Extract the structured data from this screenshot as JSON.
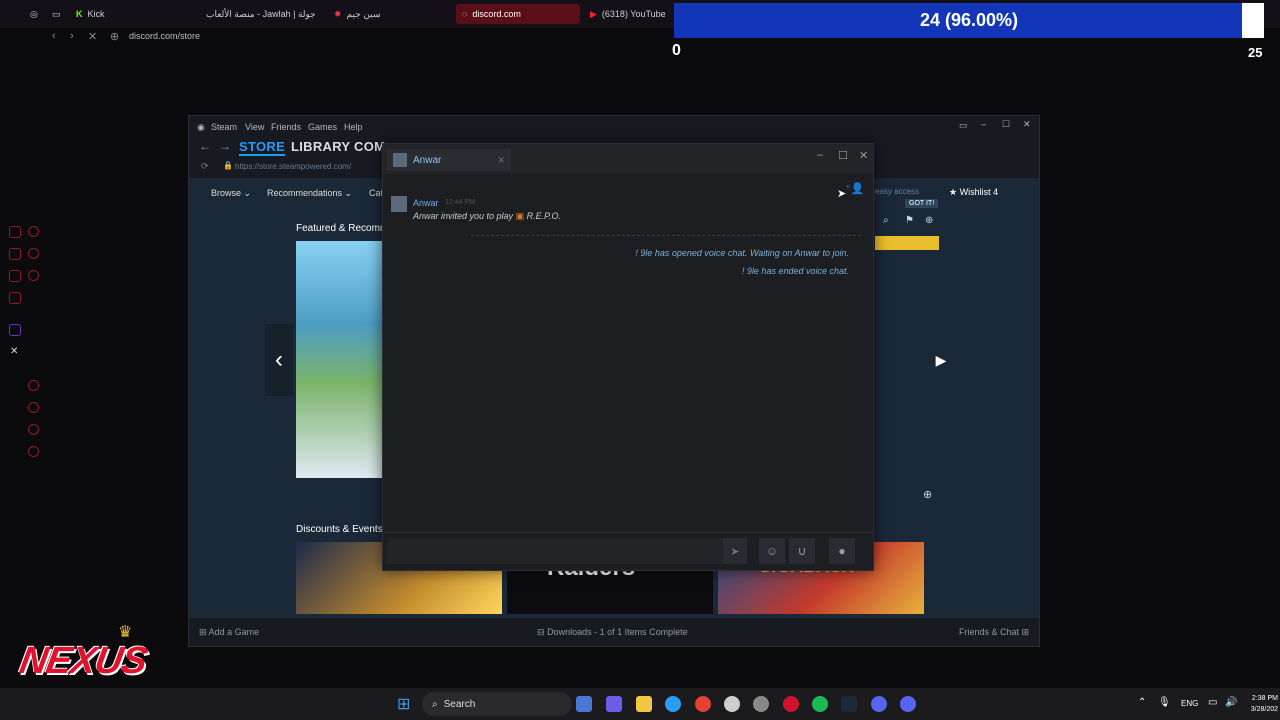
{
  "browser": {
    "tabs": [
      {
        "label": "Kick"
      },
      {
        "label": "منصة الألعاب - Jawlah | جولة"
      },
      {
        "label": "سبن جيم"
      },
      {
        "label": "discord.com"
      },
      {
        "label": "(6318) YouTube"
      }
    ],
    "url": "discord.com/store"
  },
  "overlay": {
    "progress_text": "24 (96.00%)",
    "progress_value": 0.96,
    "counter_left": "0",
    "counter_right": "25"
  },
  "steam": {
    "menu": [
      "Steam",
      "View",
      "Friends",
      "Games",
      "Help"
    ],
    "nav": {
      "store": "STORE",
      "library": "LIBRARY",
      "community": "COM"
    },
    "url": "https://store.steampowered.com/",
    "subnav": [
      "Browse",
      "Recommendations",
      "Cat"
    ],
    "wishlist": "Wishlist 4",
    "easy_access": "easy access",
    "got_it": "GOT IT!",
    "featured_heading": "Featured & Recomm",
    "discounts_heading": "Discounts & Events",
    "tiles": [
      {
        "label": ""
      },
      {
        "label": "Raiders"
      },
      {
        "label": "GIGABASH"
      }
    ],
    "footer": {
      "add_game": "Add a Game",
      "downloads": "Downloads - 1 of 1 Items Complete",
      "friends_chat": "Friends & Chat"
    }
  },
  "chat": {
    "tab_name": "Anwar",
    "sender": "Anwar",
    "time": "12:44 PM",
    "message_prefix": "Anwar invited you to play",
    "game": "R.E.P.O.",
    "system_lines": [
      "! 9le has opened voice chat. Waiting on Anwar to join.",
      "! 9le has ended voice chat."
    ],
    "input_placeholder": ""
  },
  "taskbar": {
    "search_label": "Search",
    "lang": "ENG",
    "time": "2:38 PM",
    "date": "3/28/202"
  },
  "logo": {
    "text": "NEXUS"
  },
  "colors": {
    "accent": "#c21d3a",
    "progress": "#1336b8",
    "steam_bg": "#1b2838",
    "chat_link": "#6fb1e8"
  }
}
